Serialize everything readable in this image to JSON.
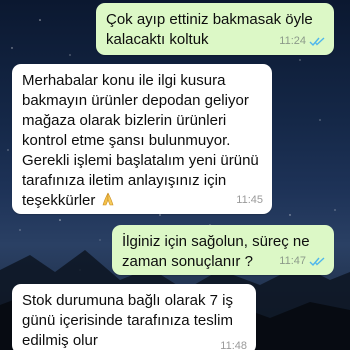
{
  "chat": {
    "messages": [
      {
        "direction": "outgoing",
        "text": "Çok ayıp ettiniz bakmasak öyle\nkalacaktı koltuk",
        "time": "11:24",
        "status": "read-double-check-icon"
      },
      {
        "direction": "incoming",
        "text": "Merhabalar konu ile ilgi kusura\nbakmayın ürünler depodan geliyor\nmağaza olarak bizlerin ürünleri\nkontrol etme şansı bulunmuyor.\nGerekli işlemi başlatalım yeni ürünü\ntarafınıza iletim anlayışınız için\nteşekkürler",
        "emoji": "folded-hands-emoji",
        "time": "11:45"
      },
      {
        "direction": "outgoing",
        "text": "İlginiz için sağolun, süreç ne\nzaman sonuçlanır ?",
        "time": "11:47",
        "status": "read-double-check-icon"
      },
      {
        "direction": "incoming",
        "text": "Stok durumuna bağlı olarak 7 iş\ngünü içerisinde tarafınıza teslim\nedilmiş olur",
        "time": "11:48"
      }
    ]
  },
  "colors": {
    "outgoing_bubble": "#dcf8c6",
    "incoming_bubble": "#ffffff",
    "read_ticks": "#4fb6ec"
  }
}
